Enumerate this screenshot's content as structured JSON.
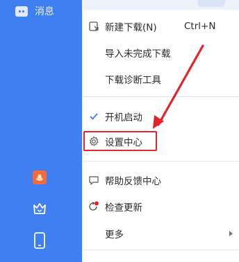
{
  "sidebar": {
    "message_label": "消息"
  },
  "menu": {
    "items": [
      {
        "label": "新建下载(N)",
        "shortcut": "Ctrl+N",
        "icon": "new-download-icon"
      },
      {
        "label": "导入未完成下载"
      },
      {
        "label": "下载诊断工具"
      },
      {
        "label": "开机启动",
        "checked": true
      },
      {
        "label": "设置中心",
        "icon": "gear-icon",
        "highlighted": true
      },
      {
        "label": "帮助反馈中心",
        "icon": "feedback-icon"
      },
      {
        "label": "检查更新",
        "icon": "update-icon"
      },
      {
        "label": "更多",
        "has_submenu": true
      }
    ]
  },
  "colors": {
    "sidebar_blue": "#3f7ff2",
    "annotation_red": "#e0242a",
    "check_blue": "#3f7ff2"
  }
}
